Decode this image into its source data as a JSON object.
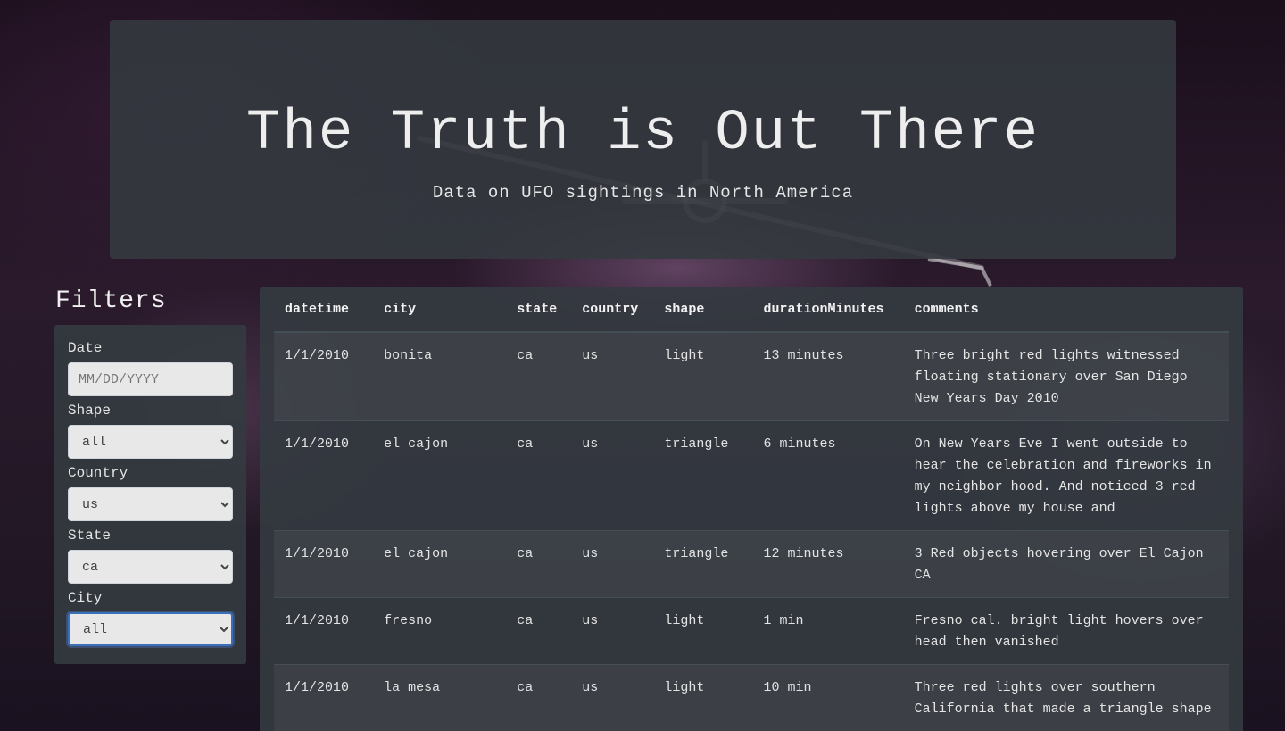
{
  "header": {
    "title": "The Truth is Out There",
    "subtitle": "Data on UFO sightings in North America"
  },
  "filters": {
    "title": "Filters",
    "date": {
      "label": "Date",
      "placeholder": "MM/DD/YYYY",
      "value": ""
    },
    "shape": {
      "label": "Shape",
      "selected": "all"
    },
    "country": {
      "label": "Country",
      "selected": "us"
    },
    "state": {
      "label": "State",
      "selected": "ca"
    },
    "city": {
      "label": "City",
      "selected": "all"
    }
  },
  "table": {
    "columns": [
      "datetime",
      "city",
      "state",
      "country",
      "shape",
      "durationMinutes",
      "comments"
    ],
    "rows": [
      {
        "datetime": "1/1/2010",
        "city": "bonita",
        "state": "ca",
        "country": "us",
        "shape": "light",
        "duration": "13 minutes",
        "comments": "Three bright red lights witnessed floating stationary over San Diego New Years Day 2010"
      },
      {
        "datetime": "1/1/2010",
        "city": "el cajon",
        "state": "ca",
        "country": "us",
        "shape": "triangle",
        "duration": "6 minutes",
        "comments": "On New Years Eve I went outside to hear the celebration and fireworks in my neighbor hood. And noticed 3 red lights above my house and"
      },
      {
        "datetime": "1/1/2010",
        "city": "el cajon",
        "state": "ca",
        "country": "us",
        "shape": "triangle",
        "duration": "12 minutes",
        "comments": "3 Red objects hovering over El Cajon CA"
      },
      {
        "datetime": "1/1/2010",
        "city": "fresno",
        "state": "ca",
        "country": "us",
        "shape": "light",
        "duration": "1 min",
        "comments": "Fresno cal. bright light hovers over head then vanished"
      },
      {
        "datetime": "1/1/2010",
        "city": "la mesa",
        "state": "ca",
        "country": "us",
        "shape": "light",
        "duration": "10 min",
        "comments": "Three red lights over southern California that made a triangle shape"
      }
    ]
  }
}
